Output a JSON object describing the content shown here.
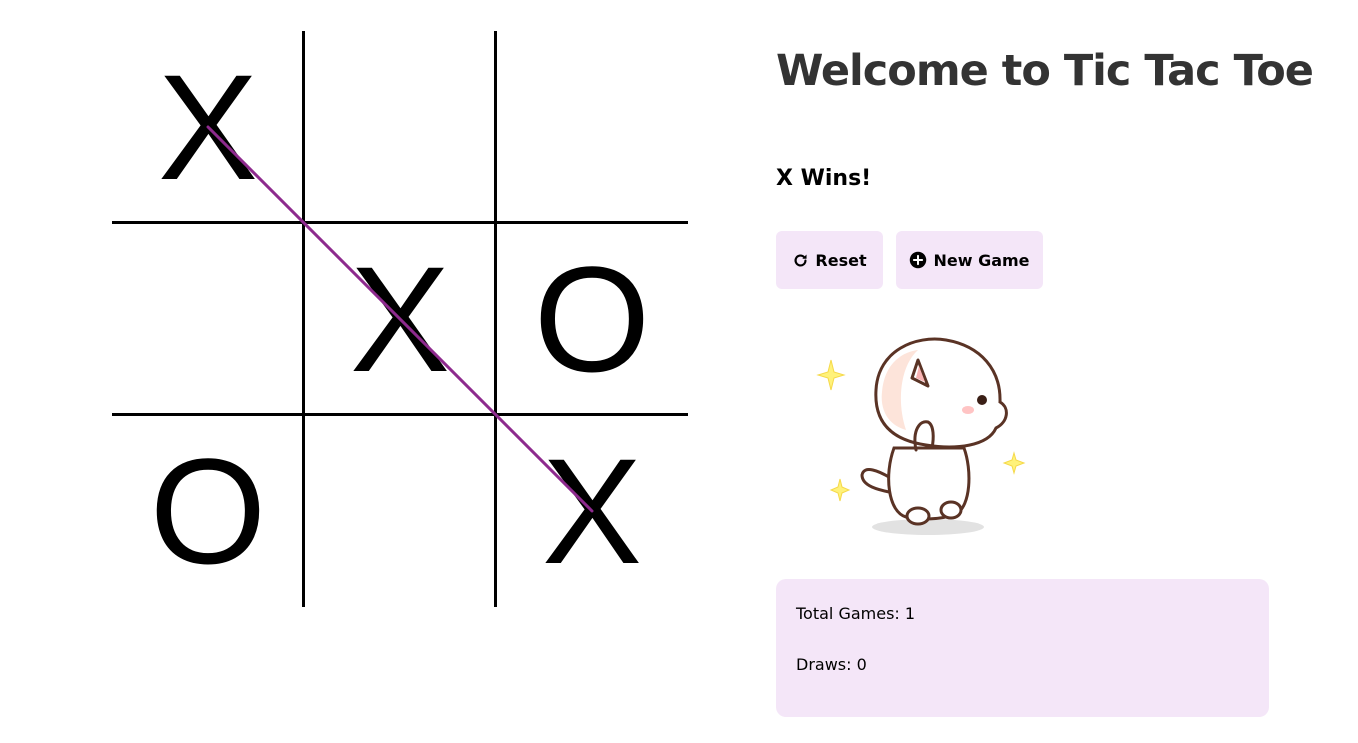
{
  "game": {
    "title": "Welcome to Tic Tac Toe",
    "status": "X Wins!",
    "board": [
      "X",
      "",
      "",
      "",
      "X",
      "O",
      "O",
      "",
      "X"
    ],
    "winning_line": [
      0,
      4,
      8
    ],
    "win_color": "#8e2a8e"
  },
  "controls": {
    "reset_label": "Reset",
    "reset_icon": "refresh-icon",
    "new_game_label": "New Game",
    "new_game_icon": "plus-circle-icon"
  },
  "mascot": {
    "icon": "cat-mascot"
  },
  "stats": {
    "total_games": "Total Games: 1",
    "draws": "Draws: 0"
  },
  "colors": {
    "panel_bg": "#f4e6f8",
    "title": "#333333",
    "accent": "#8e2a8e"
  }
}
